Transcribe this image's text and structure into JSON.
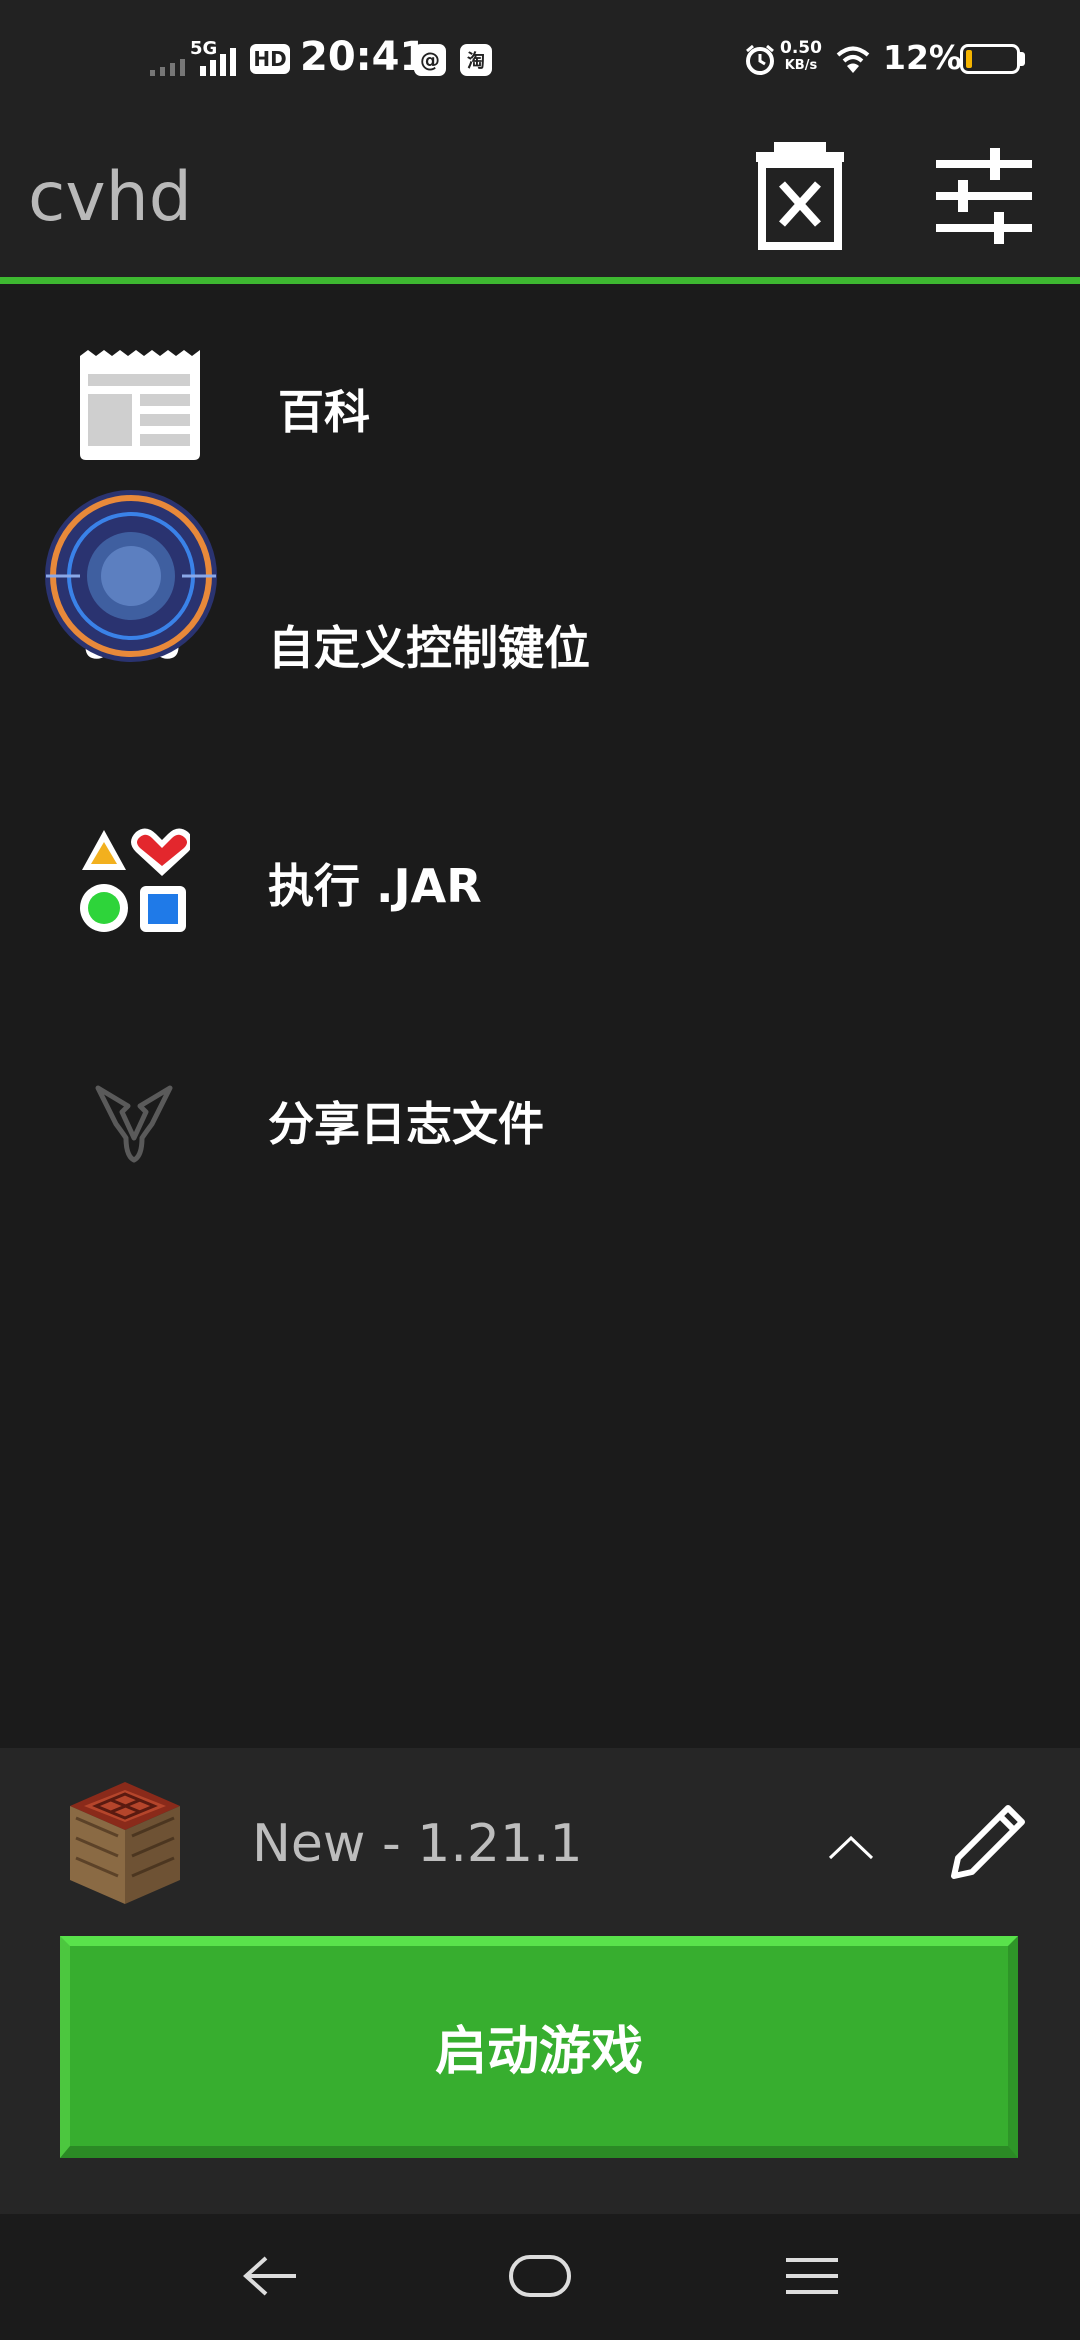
{
  "status_bar": {
    "network": "5G",
    "hd": "HD",
    "time": "20:41",
    "app_icon_1": "@",
    "app_icon_2": "淘",
    "speed_value": "0.50",
    "speed_unit": "KB/s",
    "battery_percent": "12%",
    "battery_level": 0.12,
    "battery_color": "#f5b400"
  },
  "header": {
    "title": "cvhd",
    "delete_icon": "clear-delete-icon",
    "settings_icon": "sliders-settings-icon",
    "accent_color": "#3eb831"
  },
  "menu": {
    "items": [
      {
        "label": "百科",
        "icon": "newspaper-wiki-icon"
      },
      {
        "label": "自定义控制键位",
        "icon": "gamepad-controls-icon"
      },
      {
        "label": "执行 .JAR",
        "icon": "shapes-jar-icon"
      },
      {
        "label": "分享日志文件",
        "icon": "share-log-icon"
      }
    ]
  },
  "profile": {
    "name": "New - 1.21.1",
    "icon": "crafting-table-icon",
    "toggle_icon": "chevron-up-icon",
    "edit_icon": "pencil-icon"
  },
  "launch": {
    "label": "启动游戏",
    "color": "#37ae2f"
  },
  "nav": {
    "back_icon": "back-arrow-icon",
    "home_icon": "home-pill-icon",
    "menu_icon": "recents-menu-icon"
  }
}
